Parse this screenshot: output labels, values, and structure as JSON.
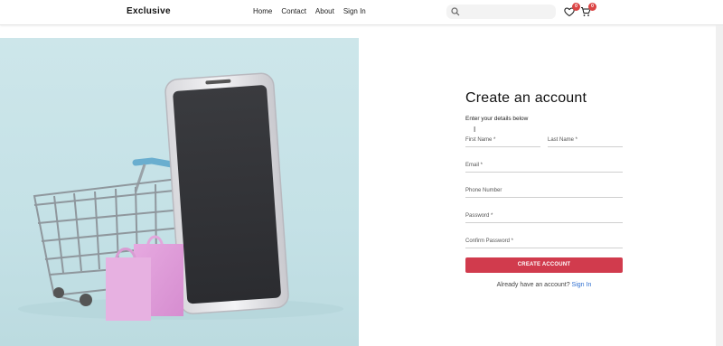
{
  "header": {
    "brand": "Exclusive",
    "nav": [
      "Home",
      "Contact",
      "About",
      "Sign In"
    ],
    "search_placeholder": "",
    "wishlist_count": "0",
    "cart_count": "0"
  },
  "form": {
    "title": "Create an account",
    "subtitle": "Enter your details below",
    "fields": {
      "first_name": "First Name *",
      "last_name": "Last Name *",
      "email": "Email *",
      "phone": "Phone Number",
      "password": "Password *",
      "confirm_password": "Confirm Password *"
    },
    "submit_label": "CREATE ACCOUNT",
    "have_account": "Already have an account?",
    "signin_link": "Sign In"
  },
  "colors": {
    "accent": "#d13b4d",
    "badge": "#db4444",
    "link": "#2f6fd0",
    "hero_bg": "#c4e1e6"
  },
  "icons": [
    "search-icon",
    "heart-icon",
    "cart-icon"
  ]
}
